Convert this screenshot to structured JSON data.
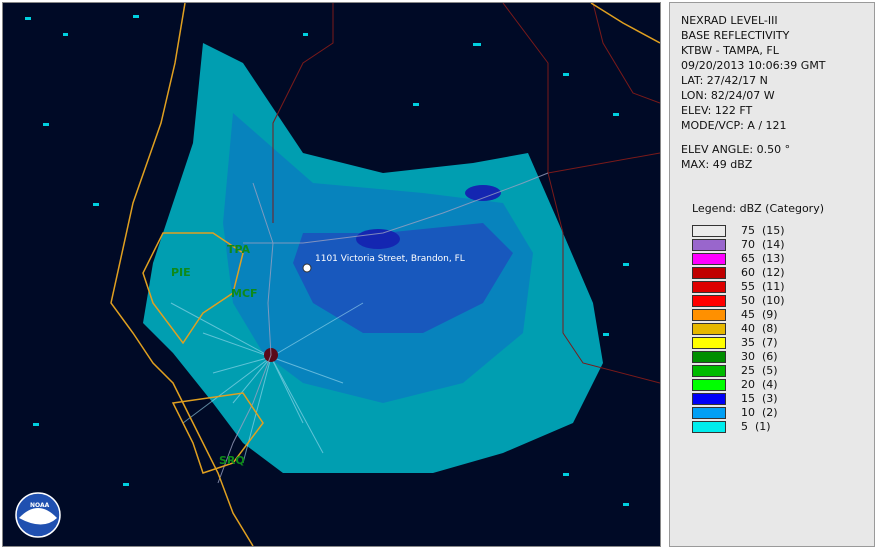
{
  "product": {
    "title": "NEXRAD LEVEL-III",
    "type": "BASE REFLECTIVITY",
    "station": "KTBW - TAMPA, FL",
    "datetime": "09/20/2013 10:06:39 GMT",
    "lat": "LAT: 27/42/17 N",
    "lon": "LON: 82/24/07 W",
    "elev": "ELEV: 122 FT",
    "mode": "MODE/VCP: A / 121",
    "elev_angle": "ELEV ANGLE: 0.50 °",
    "max": "MAX: 49 dBZ"
  },
  "legend": {
    "title": "Legend: dBZ (Category)",
    "items": [
      {
        "label": "75  (15)",
        "color": "#ebebeb"
      },
      {
        "label": "70  (14)",
        "color": "#9966cc"
      },
      {
        "label": "65  (13)",
        "color": "#ff00ff"
      },
      {
        "label": "60  (12)",
        "color": "#c00000"
      },
      {
        "label": "55  (11)",
        "color": "#dd0000"
      },
      {
        "label": "50  (10)",
        "color": "#ff0000"
      },
      {
        "label": "45  (9)",
        "color": "#ff9000"
      },
      {
        "label": "40  (8)",
        "color": "#e6b800"
      },
      {
        "label": "35  (7)",
        "color": "#ffff00"
      },
      {
        "label": "30  (6)",
        "color": "#008e00"
      },
      {
        "label": "25  (5)",
        "color": "#00bb00"
      },
      {
        "label": "20  (4)",
        "color": "#00ff00"
      },
      {
        "label": "15  (3)",
        "color": "#0000f6"
      },
      {
        "label": "10  (2)",
        "color": "#019ff4"
      },
      {
        "label": "5  (1)",
        "color": "#00ecec"
      }
    ]
  },
  "map": {
    "cities": [
      {
        "name": "TPA"
      },
      {
        "name": "PIE"
      },
      {
        "name": "MCF"
      },
      {
        "name": "SRQ"
      }
    ],
    "marker_label": "1101 Victoria Street, Brandon, FL",
    "logo_text": "NOAA",
    "colors": {
      "background": "#000a26",
      "coast": "#e0a020",
      "county": "#7a1a1a",
      "roads": "#9aa0c0"
    }
  }
}
